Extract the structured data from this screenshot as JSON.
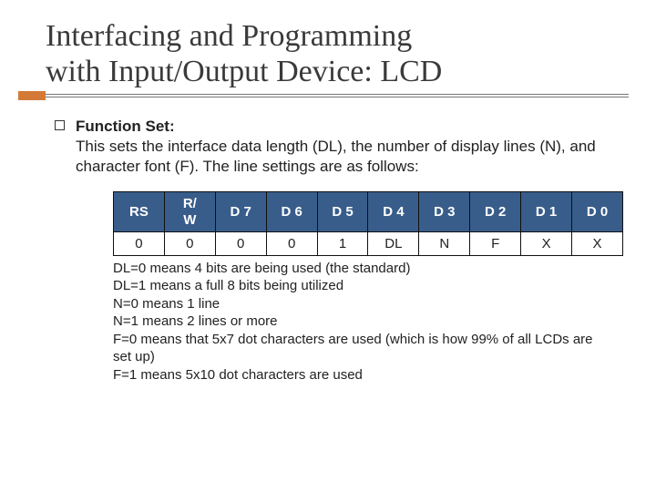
{
  "title_line1": "Interfacing and Programming",
  "title_line2": "with Input/Output Device: LCD",
  "section": {
    "heading": "Function Set:",
    "desc": "This sets the interface data length (DL), the number of display lines (N), and character font (F). The line settings are as follows:"
  },
  "table": {
    "headers": [
      "RS",
      "R/\nW",
      "D 7",
      "D 6",
      "D 5",
      "D 4",
      "D 3",
      "D 2",
      "D 1",
      "D 0"
    ],
    "row": [
      "0",
      "0",
      "0",
      "0",
      "1",
      "DL",
      "N",
      "F",
      "X",
      "X"
    ]
  },
  "notes": [
    "DL=0 means 4 bits are being used (the standard)",
    "DL=1 means a full 8 bits being utilized",
    "N=0 means 1 line",
    "N=1 means 2 lines or more",
    "F=0 means that 5x7 dot characters are used (which is how 99% of all LCDs are set up)",
    "F=1 means 5x10 dot characters are used"
  ]
}
